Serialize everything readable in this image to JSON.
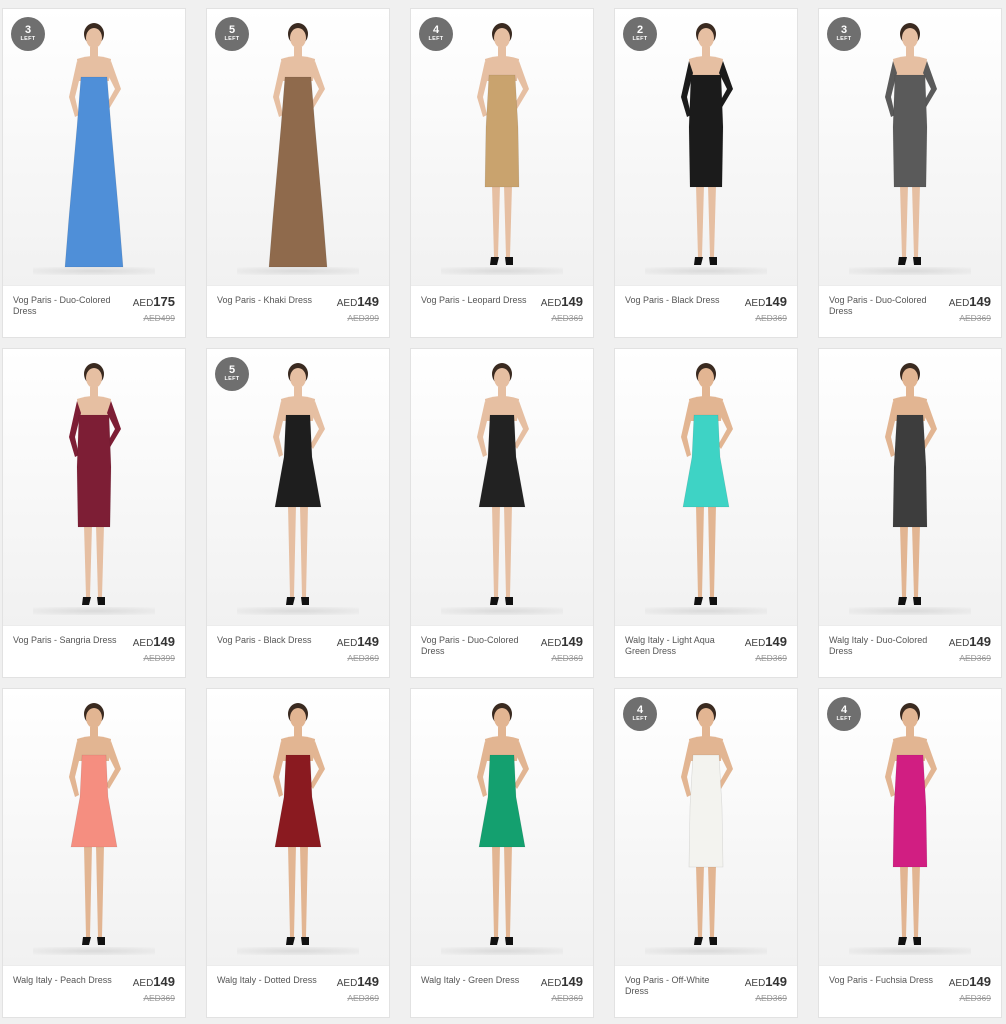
{
  "products": [
    {
      "name": "Vog Paris - Duo-Colored Dress",
      "currency": "AED",
      "price": "175",
      "old_price": "AED499",
      "badge": {
        "count": "3",
        "label": "LEFT"
      },
      "dress_color": "#4f8fd8",
      "dress_style": "gown",
      "skin": "#e6bfa2"
    },
    {
      "name": "Vog Paris - Khaki Dress",
      "currency": "AED",
      "price": "149",
      "old_price": "AED399",
      "badge": {
        "count": "5",
        "label": "LEFT"
      },
      "dress_color": "#8f6a4c",
      "dress_style": "gown",
      "skin": "#e6bfa2"
    },
    {
      "name": "Vog Paris - Leopard Dress",
      "currency": "AED",
      "price": "149",
      "old_price": "AED369",
      "badge": {
        "count": "4",
        "label": "LEFT"
      },
      "dress_color": "#c9a36e",
      "dress_style": "bodycon",
      "skin": "#e6bfa2"
    },
    {
      "name": "Vog Paris - Black Dress",
      "currency": "AED",
      "price": "149",
      "old_price": "AED369",
      "badge": {
        "count": "2",
        "label": "LEFT"
      },
      "dress_color": "#1b1b1b",
      "dress_style": "sleeve",
      "skin": "#e6bfa2"
    },
    {
      "name": "Vog Paris - Duo-Colored Dress",
      "currency": "AED",
      "price": "149",
      "old_price": "AED369",
      "badge": {
        "count": "3",
        "label": "LEFT"
      },
      "dress_color": "#5a5a5a",
      "dress_style": "sleeve",
      "skin": "#e6bfa2"
    },
    {
      "name": "Vog Paris - Sangria Dress",
      "currency": "AED",
      "price": "149",
      "old_price": "AED399",
      "badge": null,
      "dress_color": "#7d1e35",
      "dress_style": "sleeve",
      "skin": "#e6bfa2"
    },
    {
      "name": "Vog Paris - Black Dress",
      "currency": "AED",
      "price": "149",
      "old_price": "AED369",
      "badge": {
        "count": "5",
        "label": "LEFT"
      },
      "dress_color": "#1e1e1e",
      "dress_style": "short",
      "skin": "#e6bfa2"
    },
    {
      "name": "Vog Paris - Duo-Colored Dress",
      "currency": "AED",
      "price": "149",
      "old_price": "AED369",
      "badge": null,
      "dress_color": "#222222",
      "dress_style": "short",
      "skin": "#e6bfa2"
    },
    {
      "name": "Walg Italy - Light Aqua Green Dress",
      "currency": "AED",
      "price": "149",
      "old_price": "AED369",
      "badge": null,
      "dress_color": "#3ed3c5",
      "dress_style": "short",
      "skin": "#e2b592"
    },
    {
      "name": "Walg Italy - Duo-Colored Dress",
      "currency": "AED",
      "price": "149",
      "old_price": "AED369",
      "badge": null,
      "dress_color": "#3d3d3d",
      "dress_style": "bodycon",
      "skin": "#e2b592"
    },
    {
      "name": "Walg Italy - Peach Dress",
      "currency": "AED",
      "price": "149",
      "old_price": "AED369",
      "badge": null,
      "dress_color": "#f58e80",
      "dress_style": "short",
      "skin": "#e2b592"
    },
    {
      "name": "Walg Italy - Dotted Dress",
      "currency": "AED",
      "price": "149",
      "old_price": "AED369",
      "badge": null,
      "dress_color": "#8a1a20",
      "dress_style": "short",
      "skin": "#e2b592"
    },
    {
      "name": "Walg Italy - Green Dress",
      "currency": "AED",
      "price": "149",
      "old_price": "AED369",
      "badge": null,
      "dress_color": "#14a06f",
      "dress_style": "short",
      "skin": "#e2b592"
    },
    {
      "name": "Vog Paris - Off-White Dress",
      "currency": "AED",
      "price": "149",
      "old_price": "AED369",
      "badge": {
        "count": "4",
        "label": "LEFT"
      },
      "dress_color": "#f3f3ef",
      "dress_style": "bodycon",
      "skin": "#e2b592"
    },
    {
      "name": "Vog Paris - Fuchsia Dress",
      "currency": "AED",
      "price": "149",
      "old_price": "AED369",
      "badge": {
        "count": "4",
        "label": "LEFT"
      },
      "dress_color": "#d11e82",
      "dress_style": "bodycon",
      "skin": "#e2b592"
    }
  ]
}
